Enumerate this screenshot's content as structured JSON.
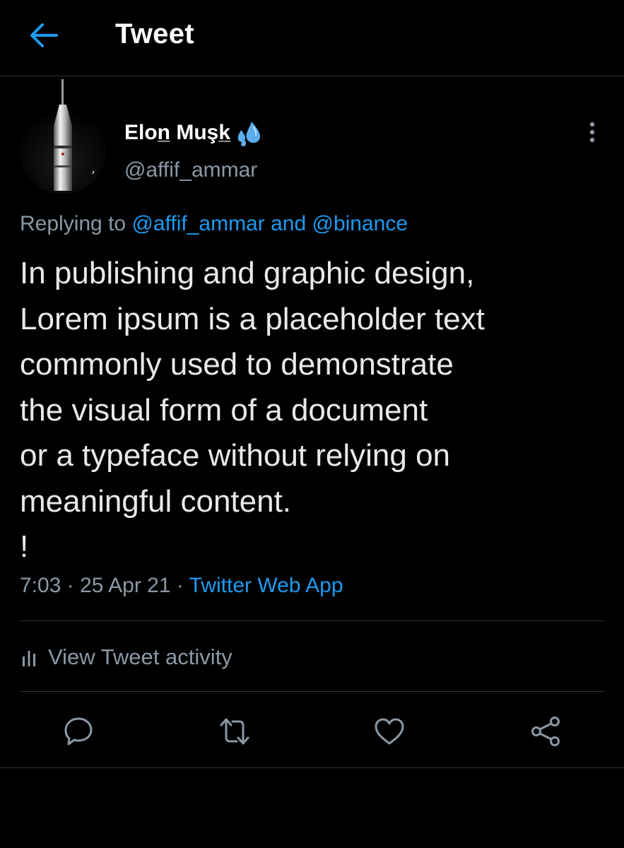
{
  "header": {
    "title": "Tweet"
  },
  "author": {
    "name": "Elon̲ Muşk̲",
    "handle": "@affif_ammar"
  },
  "reply": {
    "prefix": "Replying to",
    "mention1": "@affif_ammar",
    "conjunction": "and",
    "mention2": "@binance"
  },
  "tweet": {
    "text": "In publishing and graphic design,\nLorem ipsum is a placeholder text\ncommonly used to demonstrate\nthe visual form of a document\nor a typeface without relying on\nmeaningful content.\n!"
  },
  "meta": {
    "time": "7:03",
    "separator": "·",
    "date": "25 Apr 21",
    "source": "Twitter Web App"
  },
  "activity": {
    "label": "View Tweet activity"
  },
  "icons": {
    "back": "arrow-left-icon",
    "more": "more-vertical-icon",
    "activity": "bar-chart-icon",
    "reply": "reply-icon",
    "retweet": "retweet-icon",
    "like": "heart-icon",
    "share": "share-icon"
  },
  "colors": {
    "background": "#000000",
    "accent": "#1d9bf0",
    "text": "#e7e9ea",
    "muted": "#8b98a5",
    "divider": "#2f3336"
  }
}
